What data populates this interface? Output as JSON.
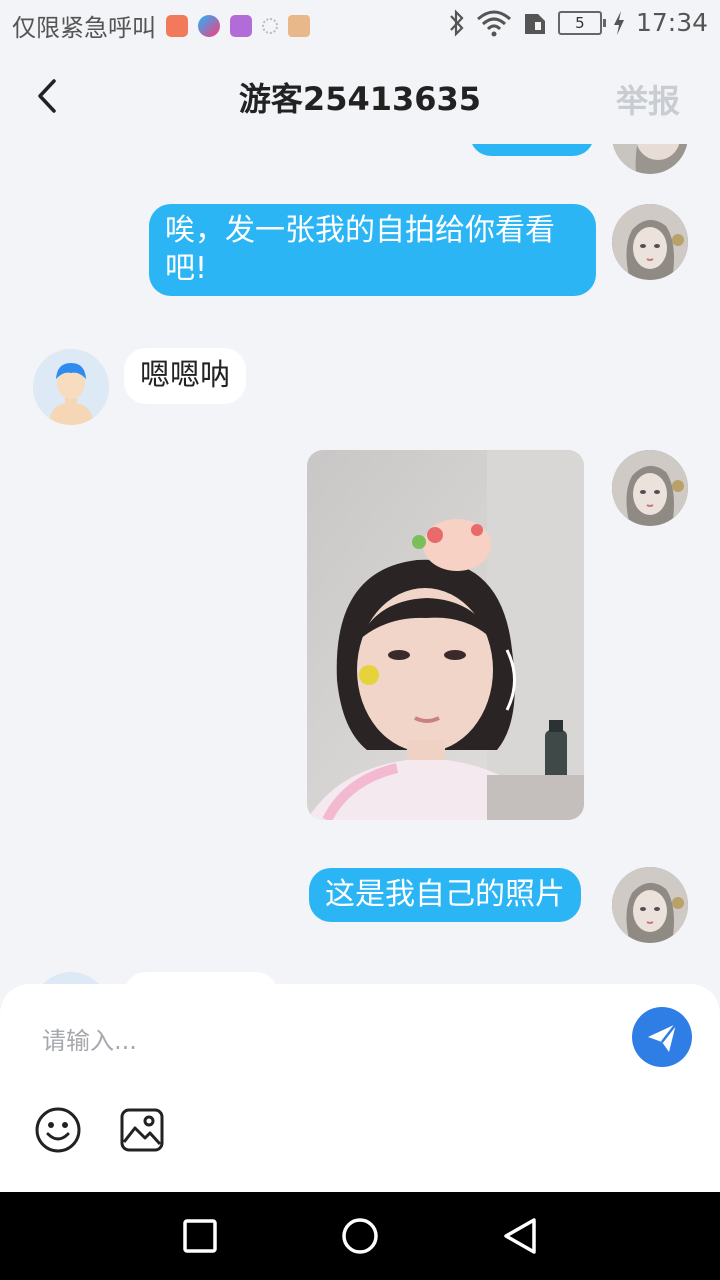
{
  "status_bar": {
    "carrier_text": "仅限紧急呼叫",
    "battery_level": "5",
    "time": "17:34",
    "icons": [
      "mail-app-icon",
      "youku-app-icon",
      "gallery-app-icon",
      "loading-icon",
      "avatar-app-icon",
      "bluetooth-icon",
      "wifi-icon",
      "sim-icon",
      "battery-icon",
      "charging-icon"
    ]
  },
  "header": {
    "title": "游客25413635",
    "report_label": "举报"
  },
  "messages": [
    {
      "sender": "me",
      "type": "text",
      "text": "唉，发一张我的自拍给你看看吧!"
    },
    {
      "sender": "them",
      "type": "text",
      "text": "嗯嗯呐"
    },
    {
      "sender": "me",
      "type": "image",
      "image": "selfie-photo"
    },
    {
      "sender": "me",
      "type": "text",
      "text": "这是我自己的照片"
    }
  ],
  "input": {
    "placeholder": "请输入..."
  },
  "colors": {
    "accent": "#2cb5f5",
    "send_button": "#2f7ee6",
    "background": "#f2f4f7",
    "report_text": "#c9ccd1"
  }
}
